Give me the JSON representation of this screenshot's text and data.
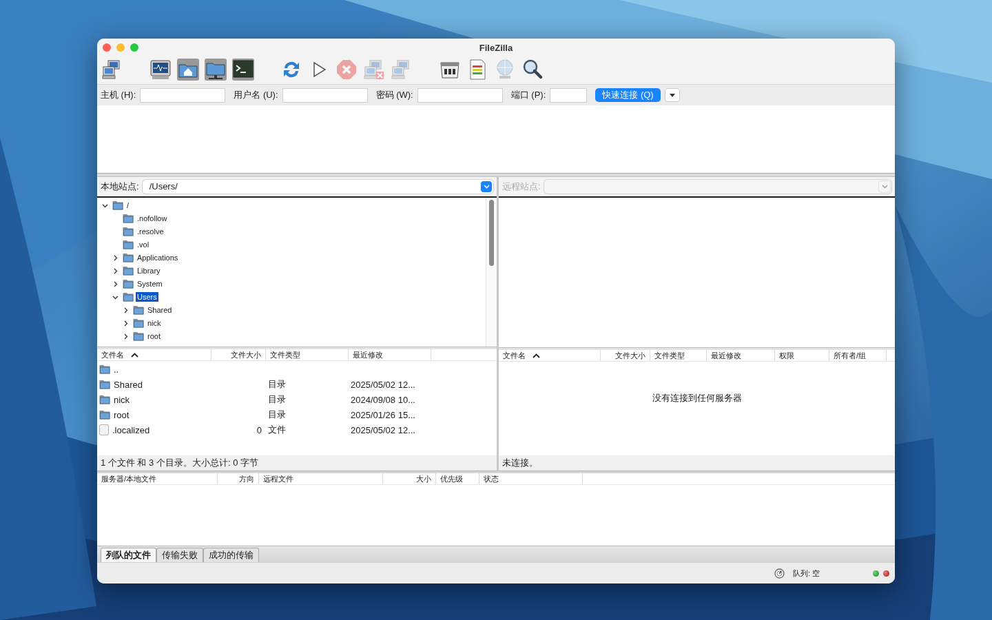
{
  "window": {
    "title": "FileZilla"
  },
  "toolbar_buttons": [
    {
      "disabled": false
    },
    {
      "disabled": false
    },
    {
      "disabled": false
    },
    {
      "disabled": false
    },
    {
      "disabled": false
    },
    {
      "disabled": false
    },
    {
      "disabled": false
    },
    {
      "disabled": true
    },
    {
      "disabled": true
    },
    {
      "disabled": true
    },
    {
      "disabled": false
    },
    {
      "disabled": false
    },
    {
      "disabled": true
    },
    {
      "disabled": false
    }
  ],
  "quickconnect": {
    "fields": [
      {
        "label": "主机 (H):"
      },
      {
        "label": "用户名 (U):"
      },
      {
        "label": "密码 (W):"
      },
      {
        "label": "端口 (P):"
      }
    ],
    "button": "快速连接 (Q)"
  },
  "local": {
    "site_label": "本地站点:",
    "path": "/Users/",
    "tree": [
      {
        "label": "/",
        "expanded": true,
        "selected": false,
        "children": [
          {
            "label": ".nofollow",
            "selected": false
          },
          {
            "label": ".resolve",
            "selected": false
          },
          {
            "label": ".vol",
            "selected": false
          },
          {
            "label": "Applications",
            "expanded": false,
            "selected": false
          },
          {
            "label": "Library",
            "expanded": false,
            "selected": false
          },
          {
            "label": "System",
            "expanded": false,
            "selected": false
          },
          {
            "label": "Users",
            "expanded": true,
            "selected": true,
            "children": [
              {
                "label": "Shared",
                "expanded": false,
                "selected": false
              },
              {
                "label": "nick",
                "expanded": false,
                "selected": false
              },
              {
                "label": "root",
                "expanded": false,
                "selected": false
              }
            ]
          }
        ]
      }
    ],
    "columns": [
      {
        "label": "文件名",
        "sorted": true
      },
      {
        "label": "文件大小",
        "sorted": false
      },
      {
        "label": "文件类型",
        "sorted": false
      },
      {
        "label": "最近修改",
        "sorted": false
      }
    ],
    "rows": [
      {
        "kind": "folder",
        "name": ".."
      },
      {
        "kind": "folder",
        "name": "Shared",
        "type": "目录",
        "modified": "2025/05/02 12..."
      },
      {
        "kind": "folder",
        "name": "nick",
        "type": "目录",
        "modified": "2024/09/08 10..."
      },
      {
        "kind": "folder",
        "name": "root",
        "type": "目录",
        "modified": "2025/01/26 15..."
      },
      {
        "kind": "file",
        "name": ".localized",
        "size": "0",
        "type": "文件",
        "modified": "2025/05/02 12..."
      }
    ],
    "status": "1 个文件 和 3 个目录。大小总计: 0 字节"
  },
  "remote": {
    "site_label": "远程站点:",
    "disabled": true,
    "columns": [
      {
        "label": "文件名",
        "sorted": true
      },
      {
        "label": "文件大小",
        "sorted": false
      },
      {
        "label": "文件类型",
        "sorted": false
      },
      {
        "label": "最近修改",
        "sorted": false
      },
      {
        "label": "权限",
        "sorted": false
      },
      {
        "label": "所有者/组",
        "sorted": false
      }
    ],
    "message": "没有连接到任何服务器",
    "status": "未连接。"
  },
  "queue": {
    "columns": [
      "服务器/本地文件",
      "方向",
      "远程文件",
      "大小",
      "优先级",
      "状态"
    ],
    "tabs": [
      {
        "label": "列队的文件",
        "selected": true
      },
      {
        "label": "传输失败",
        "selected": false
      },
      {
        "label": "成功的传输",
        "selected": false
      }
    ]
  },
  "status_bar": {
    "queue": "队列: 空"
  }
}
